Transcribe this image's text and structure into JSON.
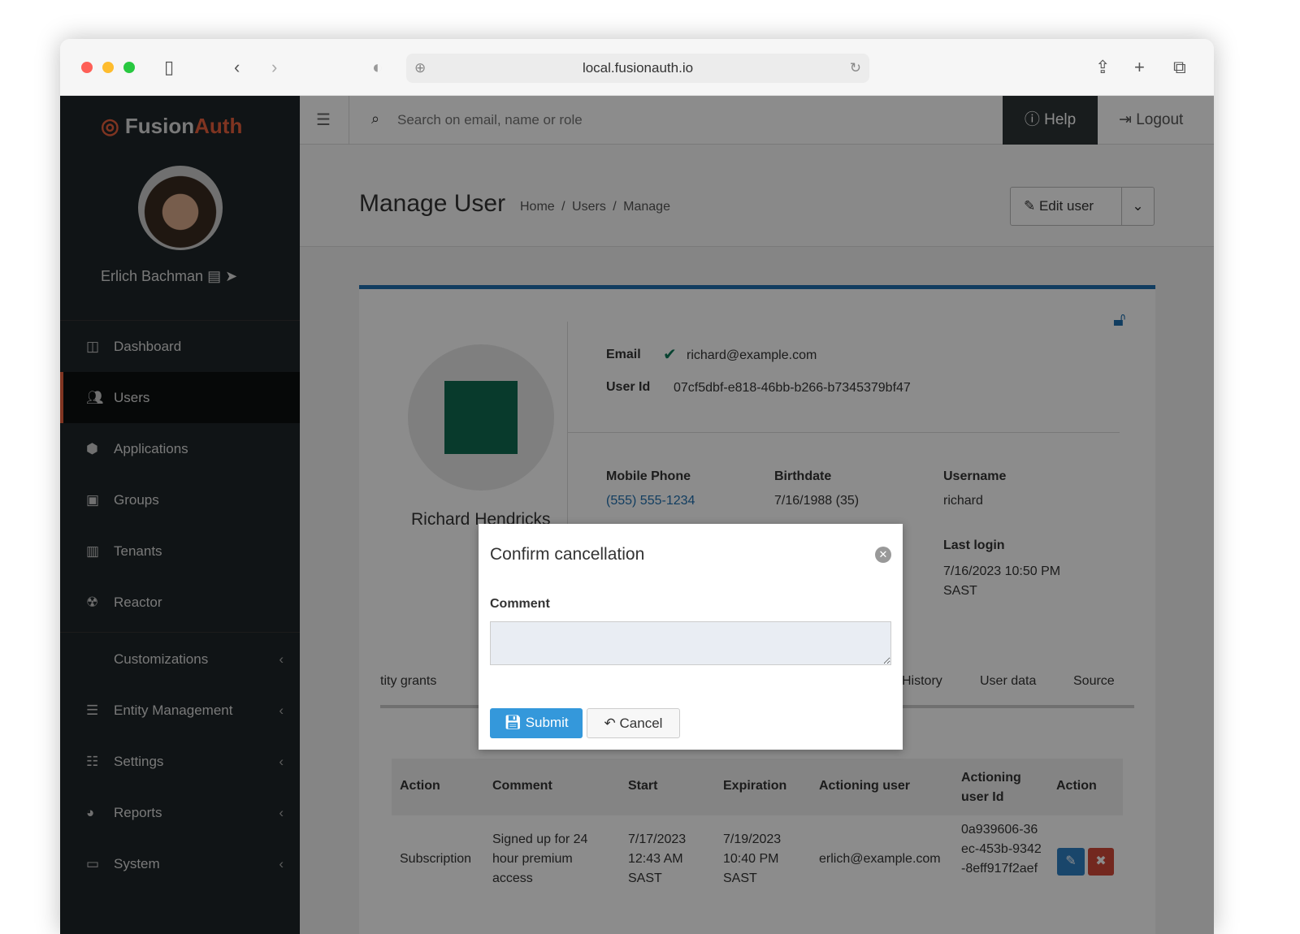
{
  "browser": {
    "url": "local.fusionauth.io"
  },
  "sidebar": {
    "brand_a": "Fusion",
    "brand_b": "Auth",
    "user_name": "Erlich Bachman",
    "items": [
      {
        "label": "Dashboard",
        "icon": "dashboard-icon"
      },
      {
        "label": "Users",
        "icon": "users-icon",
        "active": true
      },
      {
        "label": "Applications",
        "icon": "cube-icon"
      },
      {
        "label": "Groups",
        "icon": "groups-icon"
      },
      {
        "label": "Tenants",
        "icon": "building-icon"
      },
      {
        "label": "Reactor",
        "icon": "radiation-icon"
      },
      {
        "label": "Customizations",
        "icon": "code-icon"
      },
      {
        "label": "Entity Management",
        "icon": "server-icon"
      },
      {
        "label": "Settings",
        "icon": "sliders-icon"
      },
      {
        "label": "Reports",
        "icon": "pie-chart-icon"
      },
      {
        "label": "System",
        "icon": "desktop-icon"
      }
    ]
  },
  "topbar": {
    "search_placeholder": "Search on email, name or role",
    "help": "Help",
    "logout": "Logout"
  },
  "header": {
    "title": "Manage User",
    "breadcrumb": [
      "Home",
      "Users",
      "Manage"
    ],
    "edit_user": "Edit user"
  },
  "user": {
    "name": "Richard Hendricks",
    "email_label": "Email",
    "email": "richard@example.com",
    "userid_label": "User Id",
    "userid": "07cf5dbf-e818-46bb-b266-b7345379bf47",
    "phone_label": "Mobile Phone",
    "phone": "(555) 555-1234",
    "birth_label": "Birthdate",
    "birth": "7/16/1988 (35)",
    "username_label": "Username",
    "username": "richard",
    "login_label": "Last login",
    "login": "7/16/2023 10:50 PM SAST"
  },
  "tabs": [
    "tity grants",
    "History",
    "User data",
    "Source"
  ],
  "table": {
    "headers": [
      "Action",
      "Comment",
      "Start",
      "Expiration",
      "Actioning user",
      "Actioning user Id",
      "Action"
    ],
    "rows": [
      [
        "Subscription",
        "Signed up for 24 hour premium access",
        "7/17/2023 12:43 AM SAST",
        "7/19/2023 10:40 PM SAST",
        "erlich@example.com",
        "0a939606-36ec-453b-9342-8eff917f2aef"
      ]
    ]
  },
  "modal": {
    "title": "Confirm cancellation",
    "comment_label": "Comment",
    "comment_value": "",
    "submit": "Submit",
    "cancel": "Cancel"
  },
  "colors": {
    "accent": "#e8603c",
    "primary": "#3498db",
    "danger": "#c0392b",
    "card_top": "#1f6fb0"
  }
}
